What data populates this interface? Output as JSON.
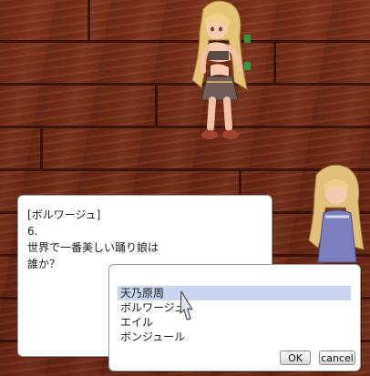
{
  "message_window": {
    "lines": [
      "[ボルワージュ]",
      "6.",
      "世界で一番美しい踊り娘は",
      "誰か？"
    ]
  },
  "menu_window": {
    "options": [
      "天乃原周",
      "ボルワージュ",
      "エイル",
      "ボンジュール"
    ],
    "selected_index": 0,
    "ok_label": "OK",
    "cancel_label": "cancel"
  },
  "colors": {
    "floor": "#6d2914",
    "selection": "#c9d6ef",
    "window": "#ffffff"
  }
}
